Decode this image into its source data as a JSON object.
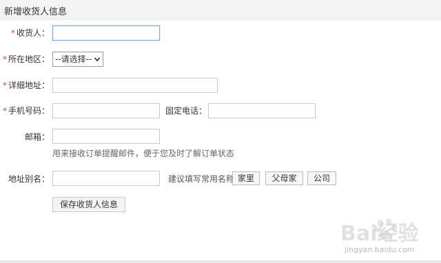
{
  "header": {
    "title": "新增收货人信息"
  },
  "form": {
    "required_mark": "*",
    "receiver": {
      "label": "收货人：",
      "value": ""
    },
    "region": {
      "label": "所在地区：",
      "selected": "--请选择--"
    },
    "address": {
      "label": "详细地址：",
      "value": ""
    },
    "mobile": {
      "label": "手机号码：",
      "value": ""
    },
    "phone": {
      "label": "固定电话：",
      "value": ""
    },
    "email": {
      "label": "邮箱：",
      "value": "",
      "hint": "用来接收订单提醒邮件，便于您及时了解订单状态"
    },
    "alias": {
      "label": "地址别名：",
      "value": "",
      "suggest_text": "建议填写常用名称",
      "suggestions": [
        "家里",
        "父母家",
        "公司"
      ]
    },
    "save_label": "保存收货人信息"
  },
  "watermark": {
    "brand": "Bai经验",
    "url": "jingyan.baidu.com"
  },
  "colors": {
    "required": "#e4393c",
    "focus_border": "#7aa7e6",
    "header_bg": "#f3f3f3"
  }
}
